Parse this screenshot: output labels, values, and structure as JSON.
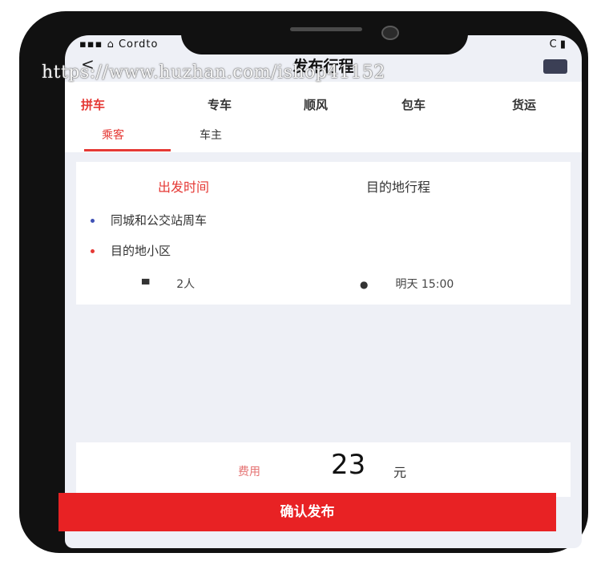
{
  "status_bar": {
    "left": "▪▪▪ ⌂ Cordto",
    "right": "C ▮"
  },
  "header": {
    "title": "发布行程",
    "back_icon": "chevron-left-icon",
    "right_icon": "message-icon"
  },
  "tabs": [
    {
      "label": "拼车"
    },
    {
      "label": "专车"
    },
    {
      "label": "顺风"
    },
    {
      "label": "包车"
    },
    {
      "label": "货运"
    }
  ],
  "sub_tabs": [
    {
      "label": "乘客"
    },
    {
      "label": "车主"
    }
  ],
  "route": {
    "start_label": "出发时间",
    "end_label": "目的地行程",
    "from": "同城和公交站周车",
    "to": "目的地小区",
    "seats": "2人",
    "time": "明天 15:00"
  },
  "fee": {
    "label": "费用",
    "value": "23",
    "unit": "元"
  },
  "confirm_label": "确认发布",
  "watermark": "https://www.huzhan.com/ishop41152",
  "colors": {
    "accent": "#e53935",
    "button": "#e82224"
  }
}
